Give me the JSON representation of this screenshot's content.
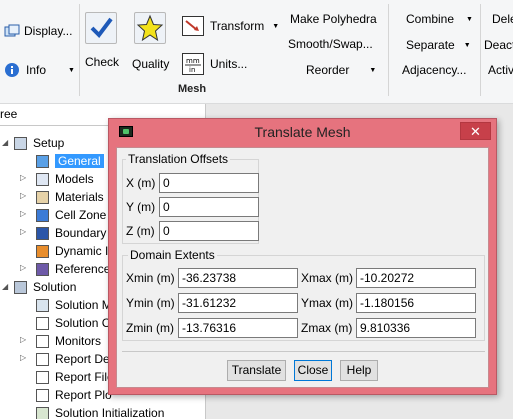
{
  "ribbon": {
    "display_label": "Display...",
    "info_label": "Info",
    "check_label": "Check",
    "quality_label": "Quality",
    "transform_label": "Transform",
    "units_label": "Units...",
    "make_polyhedra_label": "Make Polyhedra",
    "smooth_swap_label": "Smooth/Swap...",
    "reorder_label": "Reorder",
    "group_label": "Mesh",
    "combine_label": "Combine",
    "separate_label": "Separate",
    "adjacency_label": "Adjacency...",
    "dele_label": "Dele",
    "deact_label": "Deact",
    "activ_label": "Activ"
  },
  "tree": {
    "header": "ree",
    "items": [
      {
        "label": "Setup",
        "icon": "setup-icon"
      },
      {
        "label": "General",
        "icon": "general-icon",
        "selected": true
      },
      {
        "label": "Models",
        "icon": "models-icon"
      },
      {
        "label": "Materials",
        "icon": "materials-icon"
      },
      {
        "label": "Cell Zone",
        "icon": "cell-zone-icon"
      },
      {
        "label": "Boundary",
        "icon": "boundary-icon"
      },
      {
        "label": "Dynamic I",
        "icon": "dynamic-mesh-icon"
      },
      {
        "label": "Reference",
        "icon": "reference-icon"
      },
      {
        "label": "Solution",
        "icon": "solution-icon"
      },
      {
        "label": "Solution M",
        "icon": "solution-methods-icon"
      },
      {
        "label": "Solution C",
        "icon": "solution-controls-icon"
      },
      {
        "label": "Monitors",
        "icon": "monitors-icon"
      },
      {
        "label": "Report De",
        "icon": "report-definitions-icon"
      },
      {
        "label": "Report File",
        "icon": "report-file-icon"
      },
      {
        "label": "Report Plo",
        "icon": "report-plot-icon"
      },
      {
        "label": "Solution Initialization",
        "icon": "solution-init-icon"
      }
    ]
  },
  "dialog": {
    "title": "Translate Mesh",
    "offsets_title": "Translation Offsets",
    "x_label": "X (m)",
    "x_value": "0",
    "y_label": "Y (m)",
    "y_value": "0",
    "z_label": "Z (m)",
    "z_value": "0",
    "extents_title": "Domain Extents",
    "xmin_label": "Xmin (m)",
    "xmin_value": "-36.23738",
    "xmax_label": "Xmax (m)",
    "xmax_value": "-10.20272",
    "ymin_label": "Ymin (m)",
    "ymin_value": "-31.61232",
    "ymax_label": "Ymax (m)",
    "ymax_value": "-1.180156",
    "zmin_label": "Zmin (m)",
    "zmin_value": "-13.76316",
    "zmax_label": "Zmax (m)",
    "zmax_value": "9.810336",
    "translate_label": "Translate",
    "close_label": "Close",
    "help_label": "Help"
  },
  "colors": {
    "dialog_frame": "#e6737e",
    "selection": "#3399ff",
    "close_button": "#c7404a"
  }
}
